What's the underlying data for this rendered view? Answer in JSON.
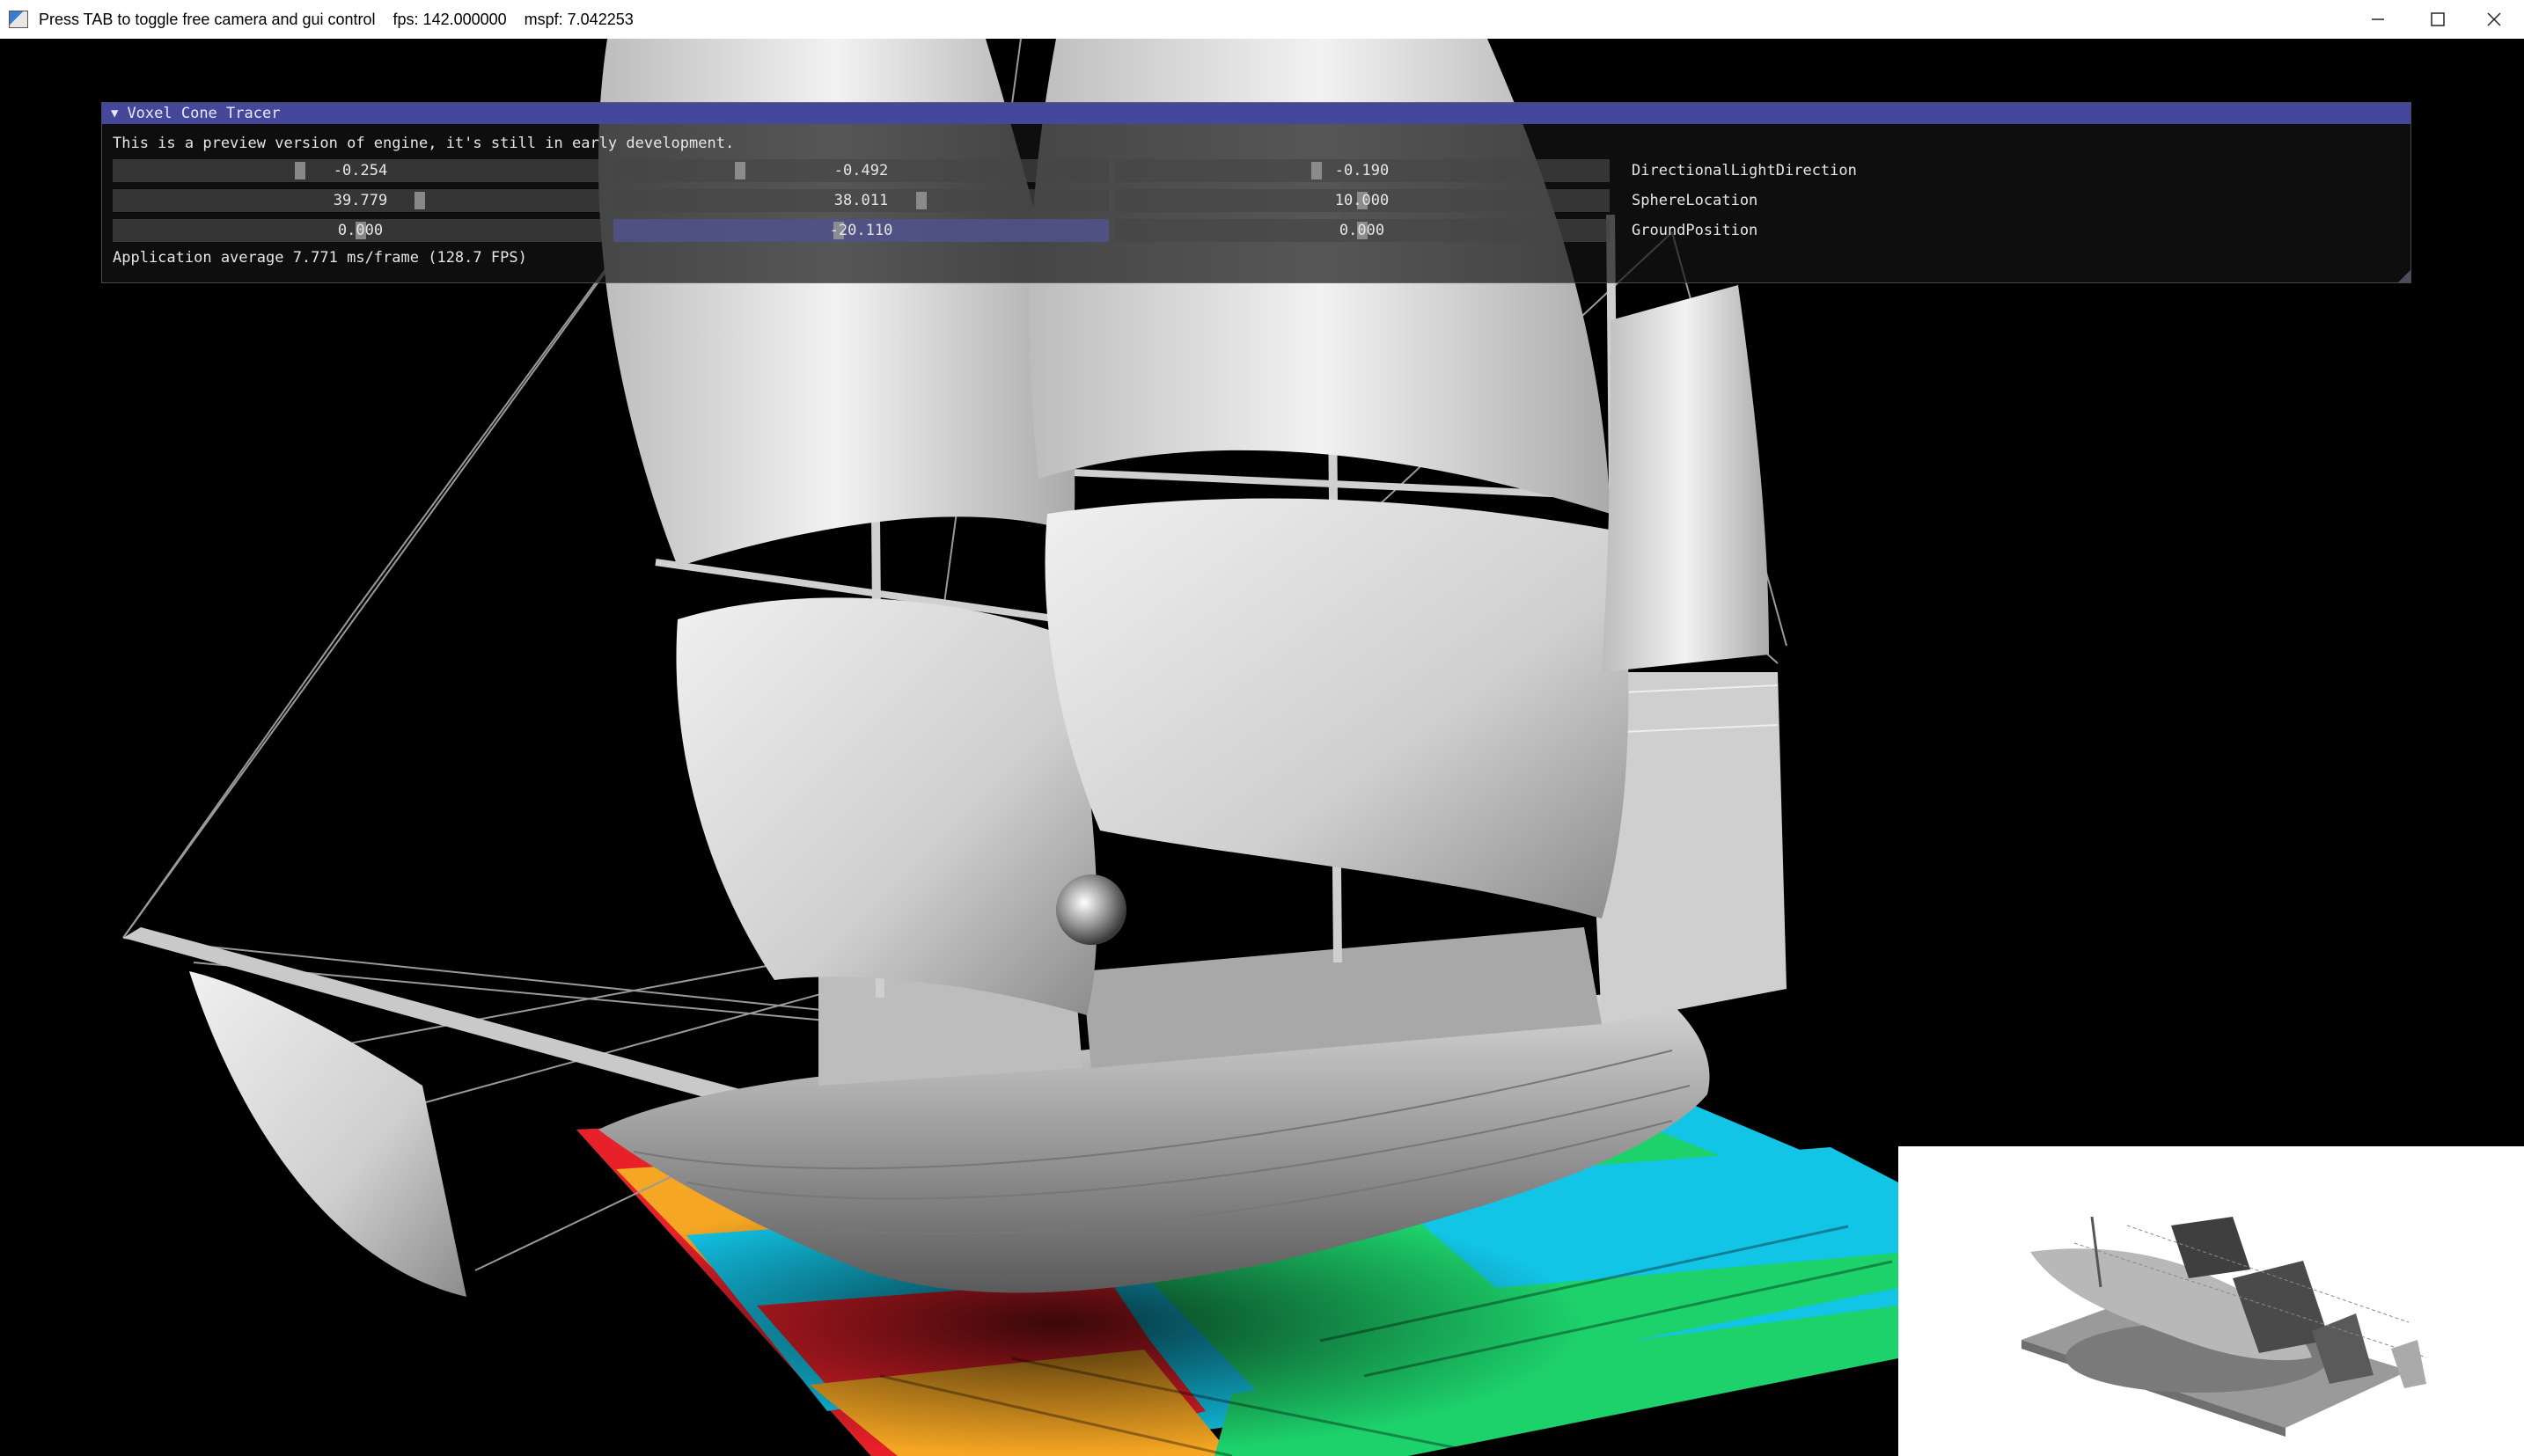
{
  "window": {
    "title": "Press TAB to toggle free camera and gui control    fps: 142.000000    mspf: 7.042253",
    "icon": "app-window-icon",
    "controls": [
      "minimize-icon",
      "maximize-icon",
      "close-icon"
    ]
  },
  "imgui": {
    "title": "Voxel Cone Tracer",
    "collapse_icon": "triangle-down-icon",
    "description": "This is a preview version of engine, it's still in early development.",
    "rows": [
      {
        "label": "DirectionalLightDirection",
        "values": [
          "-0.254",
          "-0.492",
          "-0.190"
        ]
      },
      {
        "label": "SphereLocation",
        "values": [
          "39.779",
          "38.011",
          "10.000"
        ]
      },
      {
        "label": "GroundPosition",
        "values": [
          "0.000",
          "-20.110",
          "0.000"
        ]
      }
    ],
    "stats": "Application average 7.771 ms/frame (128.7 FPS)",
    "accent_color": "#45479a"
  },
  "scene": {
    "description_colors": {
      "ground_stripes": [
        "#e8202a",
        "#f5a623",
        "#12c4e6",
        "#1dd16b"
      ],
      "background": "#000000"
    }
  }
}
